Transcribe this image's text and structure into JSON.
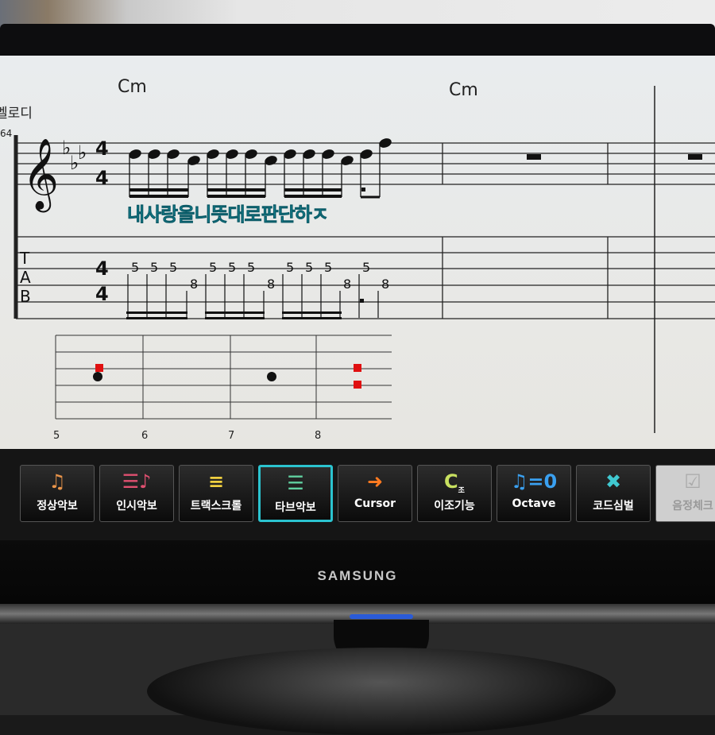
{
  "score": {
    "track_name": "멜로디",
    "measure_number": "64",
    "chords": [
      "Cm",
      "Cm"
    ],
    "key_signature": "C minor (3 flats)",
    "time_signature": {
      "top": "4",
      "bottom": "4"
    },
    "tab_label": [
      "T",
      "A",
      "B"
    ],
    "lyrics": "내사랑을니뜻대로판단하ㅈ",
    "tab_frets": [
      "5",
      "5",
      "5",
      "8",
      "5",
      "5",
      "5",
      "8",
      "5",
      "5",
      "5",
      "8",
      "5",
      "8"
    ],
    "fretboard_labels": [
      "5",
      "6",
      "7",
      "8"
    ],
    "lyrics_color": "#1aa0b0"
  },
  "toolbar": {
    "buttons": [
      {
        "label": "정상악보",
        "icon": "sheet-music-icon"
      },
      {
        "label": "인시악보",
        "icon": "notes-icon"
      },
      {
        "label": "트랙스크롤",
        "icon": "track-scroll-icon"
      },
      {
        "label": "타브악보",
        "icon": "tab-score-icon",
        "active": true
      },
      {
        "label": "Cursor",
        "icon": "arrow-right-icon"
      },
      {
        "label": "이조기능",
        "icon": "transpose-icon",
        "icon_text": "C",
        "icon_sub": "조"
      },
      {
        "label": "Octave",
        "icon": "octave-icon",
        "icon_text": "=0"
      },
      {
        "label": "코드심벌",
        "icon": "chord-symbol-icon"
      },
      {
        "label": "음정체크",
        "icon": "pitch-check-icon",
        "disabled": true
      }
    ],
    "accent": "#2bc3cf"
  },
  "monitor": {
    "brand": "SAMSUNG"
  }
}
